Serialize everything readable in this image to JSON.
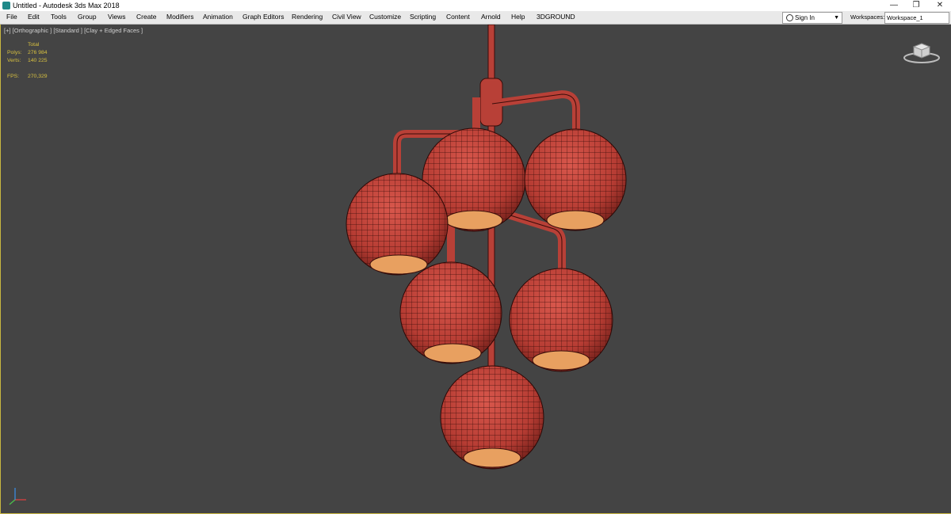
{
  "window": {
    "title": "Untitled - Autodesk 3ds Max 2018",
    "controls": [
      "—",
      "❐",
      "✕"
    ]
  },
  "menu": {
    "items": [
      "File",
      "Edit",
      "Tools",
      "Group",
      "Views",
      "Create",
      "Modifiers",
      "Animation",
      "Graph Editors",
      "Rendering",
      "Civil View",
      "Customize",
      "Scripting",
      "Content",
      "Arnold",
      "Help",
      "3DGROUND"
    ]
  },
  "account": {
    "sign_in": "Sign In",
    "workspaces_label": "Workspaces:",
    "workspace_value": "Workspace_1"
  },
  "viewport": {
    "label": "[+] [Orthographic ] [Standard ] [Clay + Edged Faces ]",
    "stats": {
      "header": "Total",
      "polys_label": "Polys:",
      "polys_value": "276 984",
      "verts_label": "Verts:",
      "verts_value": "140 225",
      "fps_label": "FPS:",
      "fps_value": "270,329"
    },
    "object_color": "#c2433a",
    "wire_color": "#3a0d0a",
    "border_color": "#c8b640"
  },
  "colors": {
    "background": "#444444",
    "menubar": "#e9e9e9",
    "stats_text": "#d7c040"
  }
}
